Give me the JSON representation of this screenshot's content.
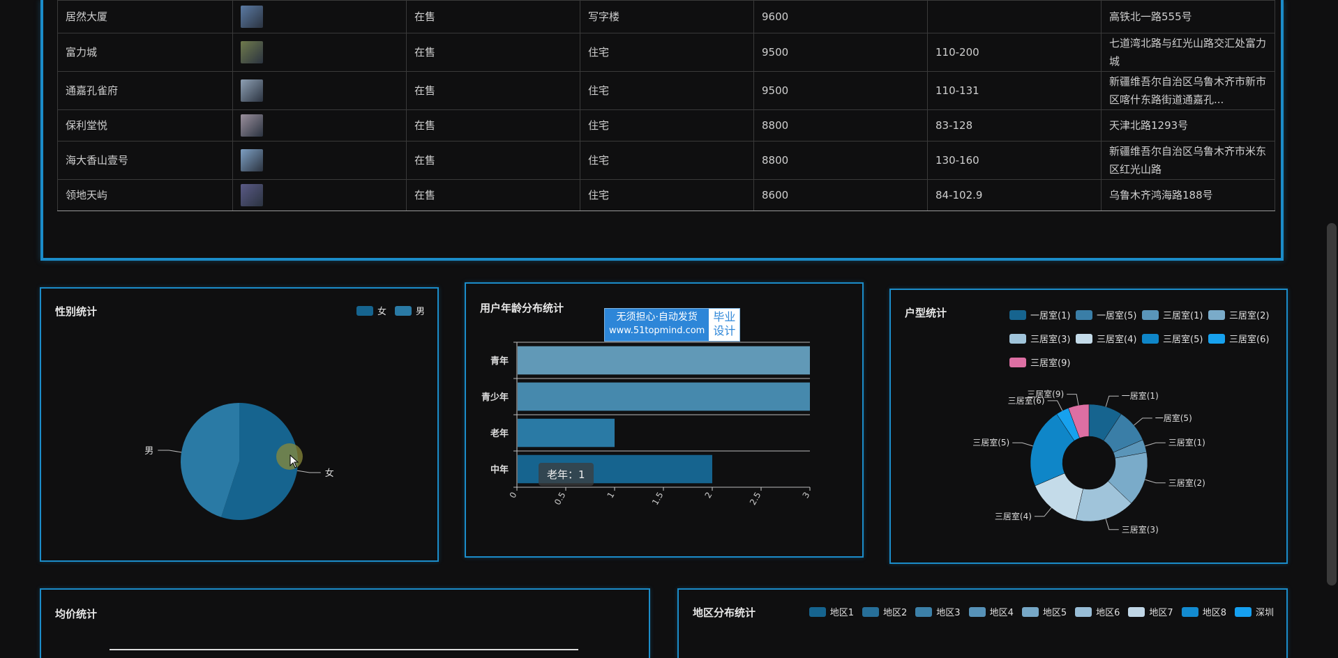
{
  "table": {
    "rows": [
      {
        "name": "居然大厦",
        "status": "在售",
        "type": "写字楼",
        "price": "9600",
        "area": "",
        "address": "高铁北一路555号",
        "thumb": "#5b7aa3"
      },
      {
        "name": "富力城",
        "status": "在售",
        "type": "住宅",
        "price": "9500",
        "area": "110-200",
        "address": "七道湾北路与红光山路交汇处富力城",
        "thumb": "#6f7a4c"
      },
      {
        "name": "通嘉孔雀府",
        "status": "在售",
        "type": "住宅",
        "price": "9500",
        "area": "110-131",
        "address": "新疆维吾尔自治区乌鲁木齐市新市区喀什东路街道通嘉孔...",
        "thumb": "#8ea0b4"
      },
      {
        "name": "保利堂悦",
        "status": "在售",
        "type": "住宅",
        "price": "8800",
        "area": "83-128",
        "address": "天津北路1293号",
        "thumb": "#9a8f9c"
      },
      {
        "name": "海大香山壹号",
        "status": "在售",
        "type": "住宅",
        "price": "8800",
        "area": "130-160",
        "address": "新疆维吾尔自治区乌鲁木齐市米东区红光山路",
        "thumb": "#7d9fc2"
      },
      {
        "name": "领地天屿",
        "status": "在售",
        "type": "住宅",
        "price": "8600",
        "area": "84-102.9",
        "address": "乌鲁木齐鸿海路188号",
        "thumb": "#5a5a86"
      }
    ]
  },
  "gender": {
    "title": "性别统计",
    "legend": [
      {
        "label": "女",
        "color": "#16648f"
      },
      {
        "label": "男",
        "color": "#2a7aa5"
      }
    ]
  },
  "age": {
    "title": "用户年龄分布统计",
    "tooltip": "老年：1"
  },
  "rooms": {
    "title": "户型统计"
  },
  "price": {
    "title": "均价统计"
  },
  "region": {
    "title": "地区分布统计",
    "legend": [
      {
        "label": "地区1",
        "color": "#16648f"
      },
      {
        "label": "地区2",
        "color": "#276f99"
      },
      {
        "label": "地区3",
        "color": "#3c80a8"
      },
      {
        "label": "地区4",
        "color": "#5792b8"
      },
      {
        "label": "地区5",
        "color": "#76a7c6"
      },
      {
        "label": "地区6",
        "color": "#98bdd6"
      },
      {
        "label": "地区7",
        "color": "#c0d6e6"
      },
      {
        "label": "地区8",
        "color": "#138bd0"
      },
      {
        "label": "深圳",
        "color": "#16a0f0"
      }
    ]
  },
  "watermark": {
    "line1": "无须担心·自动发货",
    "line2": "www.51topmind.com",
    "right1": "毕业",
    "right2": "设计"
  },
  "chart_data": [
    {
      "type": "pie",
      "labels": [
        "女",
        "男"
      ],
      "values": [
        55,
        45
      ],
      "colors": [
        "#16648f",
        "#2a7aa5"
      ],
      "legend_position": "top-right"
    },
    {
      "type": "bar",
      "orientation": "horizontal",
      "categories": [
        "中年",
        "老年",
        "青少年",
        "青年"
      ],
      "values": [
        2,
        1,
        3,
        3
      ],
      "colors": [
        "#16648f",
        "#2a7aa5",
        "#4689ad",
        "#6199b7"
      ],
      "xlim": [
        0,
        3
      ],
      "xticks": [
        "0",
        "0.5",
        "1",
        "1.5",
        "2",
        "2.5",
        "3"
      ]
    },
    {
      "type": "pie",
      "donut": true,
      "labels": [
        "一居室(1)",
        "一居室(5)",
        "三居室(1)",
        "三居室(2)",
        "三居室(3)",
        "三居室(4)",
        "三居室(5)",
        "三居室(6)",
        "三居室(9)"
      ],
      "values": [
        1.3,
        1.3,
        0.5,
        2.1,
        2.3,
        2.1,
        3.1,
        0.5,
        0.8
      ],
      "colors": [
        "#16648f",
        "#3a7ea7",
        "#5a95b9",
        "#7aabc9",
        "#a0c4da",
        "#c4dbe9",
        "#0f86c8",
        "#17a1ee",
        "#dd6fa3"
      ],
      "legend_position": "top"
    }
  ]
}
